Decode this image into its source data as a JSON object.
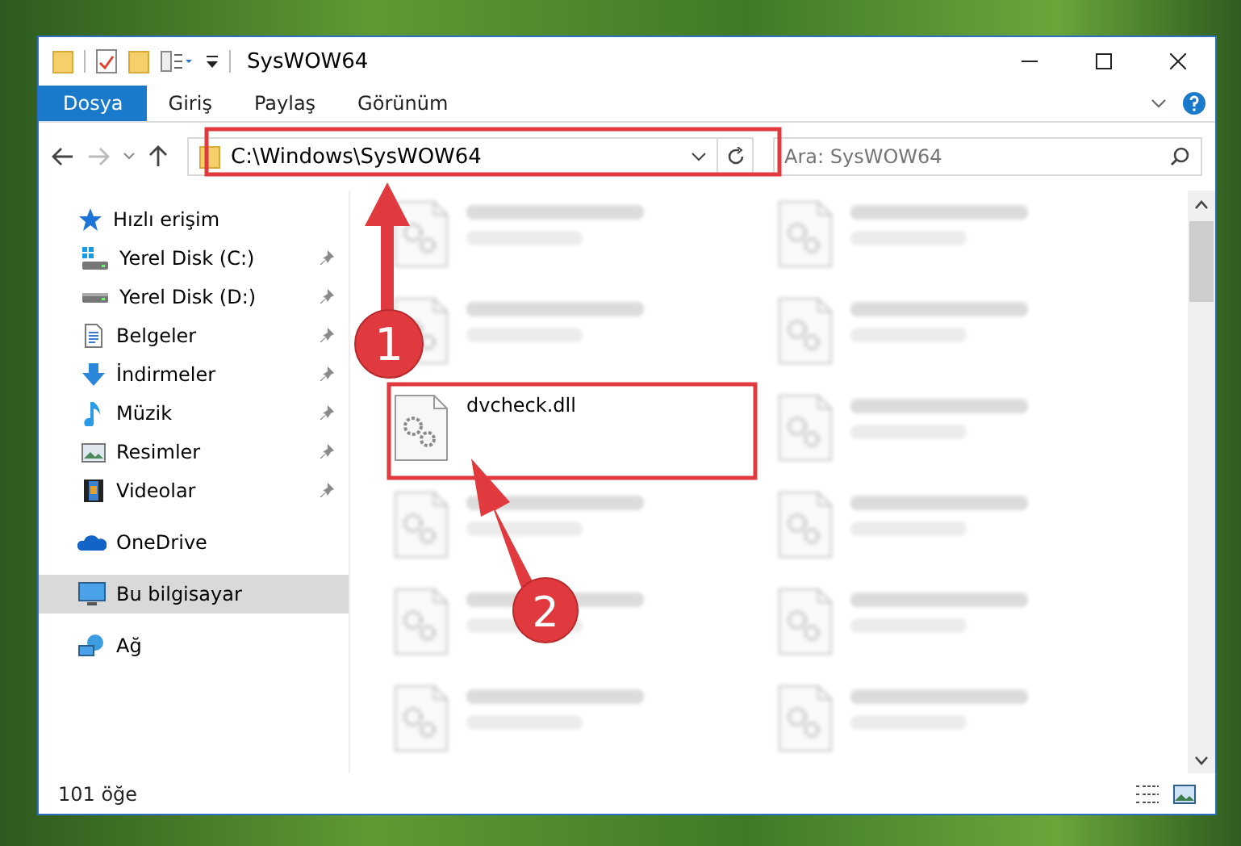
{
  "window": {
    "title": "SysWOW64"
  },
  "ribbon_tabs": [
    {
      "label": "Dosya",
      "selected": true
    },
    {
      "label": "Giriş",
      "selected": false
    },
    {
      "label": "Paylaş",
      "selected": false
    },
    {
      "label": "Görünüm",
      "selected": false
    }
  ],
  "address": {
    "path": "C:\\Windows\\SysWOW64"
  },
  "search": {
    "placeholder": "Ara: SysWOW64"
  },
  "sidebar": {
    "items": [
      {
        "label": "Hızlı erişim",
        "kind": "star",
        "selected": false,
        "children": [
          {
            "label": "Yerel Disk (C:)",
            "kind": "windrive",
            "pinned": true,
            "selected": false
          },
          {
            "label": "Yerel Disk (D:)",
            "kind": "drive",
            "pinned": true,
            "selected": false
          },
          {
            "label": "Belgeler",
            "kind": "docs",
            "pinned": true,
            "selected": false
          },
          {
            "label": "İndirmeler",
            "kind": "download",
            "pinned": true,
            "selected": false
          },
          {
            "label": "Müzik",
            "kind": "music",
            "pinned": true,
            "selected": false
          },
          {
            "label": "Resimler",
            "kind": "pictures",
            "pinned": true,
            "selected": false
          },
          {
            "label": "Videolar",
            "kind": "video",
            "pinned": true,
            "selected": false
          }
        ]
      },
      {
        "label": "OneDrive",
        "kind": "cloud",
        "selected": false
      },
      {
        "label": "Bu bilgisayar",
        "kind": "computer",
        "selected": true
      },
      {
        "label": "Ağ",
        "kind": "network",
        "selected": false
      }
    ]
  },
  "files": [
    {
      "blurred": true
    },
    {
      "blurred": true
    },
    {
      "blurred": true
    },
    {
      "blurred": true
    },
    {
      "name": "dvcheck.dll",
      "blurred": false
    },
    {
      "blurred": true
    },
    {
      "blurred": true
    },
    {
      "blurred": true
    },
    {
      "blurred": true
    },
    {
      "blurred": true
    },
    {
      "blurred": true
    },
    {
      "blurred": true
    }
  ],
  "status_bar": {
    "count": "101 öğe"
  },
  "annotations": [
    {
      "number": "1"
    },
    {
      "number": "2"
    }
  ]
}
